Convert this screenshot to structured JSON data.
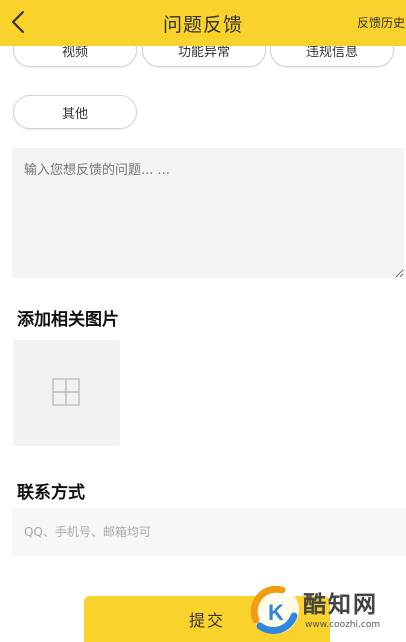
{
  "header": {
    "title": "问题反馈",
    "history_label": "反馈历史",
    "background": "#f9d22c",
    "back_icon": "chevron-left-icon"
  },
  "categories": [
    "视频",
    "功能异常",
    "违规信息",
    "其他"
  ],
  "feedback": {
    "placeholder": "输入您想反馈的问题... ..."
  },
  "images_section": {
    "title": "添加相关图片",
    "add_icon": "plus-icon"
  },
  "contact_section": {
    "title": "联系方式",
    "placeholder": "QQ、手机号、邮箱均可"
  },
  "submit": {
    "label": "提交",
    "color": "#f9d22c"
  },
  "watermark": {
    "logo_letter": "K",
    "text": "酷知网",
    "url": "www.coozhi.com"
  }
}
